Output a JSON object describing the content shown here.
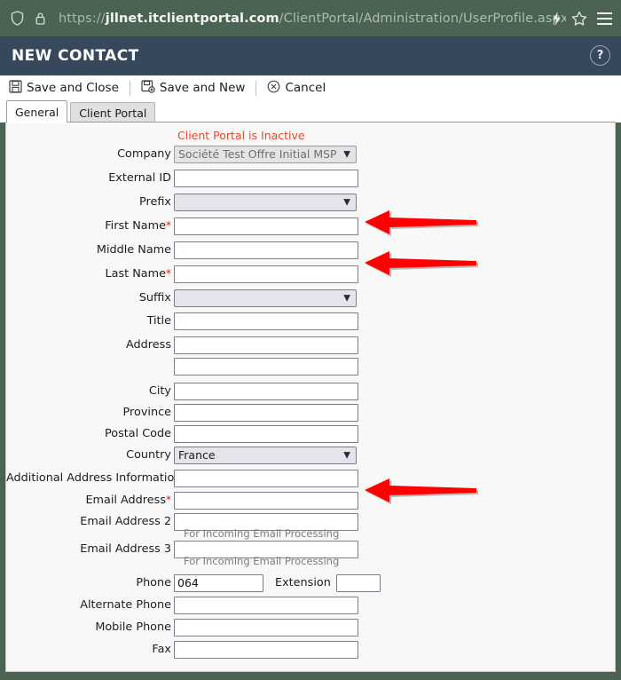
{
  "browser": {
    "url_scheme": "https://",
    "url_domain": "jllnet.itclientportal.com",
    "url_path": "/ClientPortal/Administration/UserProfile.aspx",
    "shield_icon": "shield-icon",
    "lock_icon": "lock-icon",
    "reader_icon": "lightning-bolt-icon",
    "bookmark_icon": "star-icon",
    "menu_icon": "hamburger-menu-icon"
  },
  "header": {
    "title": "NEW CONTACT",
    "help_label": "?"
  },
  "toolbar": {
    "save_and_close": "Save and Close",
    "save_and_new": "Save and New",
    "cancel": "Cancel"
  },
  "tabs": [
    {
      "label": "General",
      "active": true
    },
    {
      "label": "Client Portal",
      "active": false
    }
  ],
  "form": {
    "inactive_note": "Client Portal is Inactive",
    "fields": {
      "company": {
        "label": "Company",
        "value": "Société Test Offre Initial MSP"
      },
      "external_id": {
        "label": "External ID",
        "value": ""
      },
      "prefix": {
        "label": "Prefix",
        "value": ""
      },
      "first_name": {
        "label": "First Name",
        "value": "",
        "required": "*"
      },
      "middle_name": {
        "label": "Middle Name",
        "value": ""
      },
      "last_name": {
        "label": "Last Name",
        "value": "",
        "required": "*"
      },
      "suffix": {
        "label": "Suffix",
        "value": ""
      },
      "title": {
        "label": "Title",
        "value": ""
      },
      "address": {
        "label": "Address",
        "value": ""
      },
      "address2": {
        "label": "",
        "value": ""
      },
      "city": {
        "label": "City",
        "value": ""
      },
      "province": {
        "label": "Province",
        "value": ""
      },
      "postal_code": {
        "label": "Postal Code",
        "value": ""
      },
      "country": {
        "label": "Country",
        "value": "France"
      },
      "additional_address": {
        "label": "Additional Address Information",
        "value": ""
      },
      "email": {
        "label": "Email Address",
        "value": "",
        "required": "*"
      },
      "email2": {
        "label": "Email Address 2",
        "value": "",
        "hint": "For Incoming Email Processing"
      },
      "email3": {
        "label": "Email Address 3",
        "value": "",
        "hint": "For Incoming Email Processing"
      },
      "phone": {
        "label": "Phone",
        "value": "064"
      },
      "extension": {
        "label": "Extension",
        "value": ""
      },
      "alternate_phone": {
        "label": "Alternate Phone",
        "value": ""
      },
      "mobile_phone": {
        "label": "Mobile Phone",
        "value": ""
      },
      "fax": {
        "label": "Fax",
        "value": ""
      }
    }
  },
  "annotations": {
    "arrow_color": "#FF0000",
    "arrows": [
      {
        "name": "arrow-first-name",
        "target": "First Name"
      },
      {
        "name": "arrow-last-name",
        "target": "Last Name"
      },
      {
        "name": "arrow-email-address",
        "target": "Email Address"
      }
    ]
  },
  "colors": {
    "browser_chrome": "#4c6352",
    "app_header": "#37475c",
    "alert_text": "#e8482a",
    "required_marker": "#d21f1f",
    "panel_bg": "#f8f8f8"
  }
}
